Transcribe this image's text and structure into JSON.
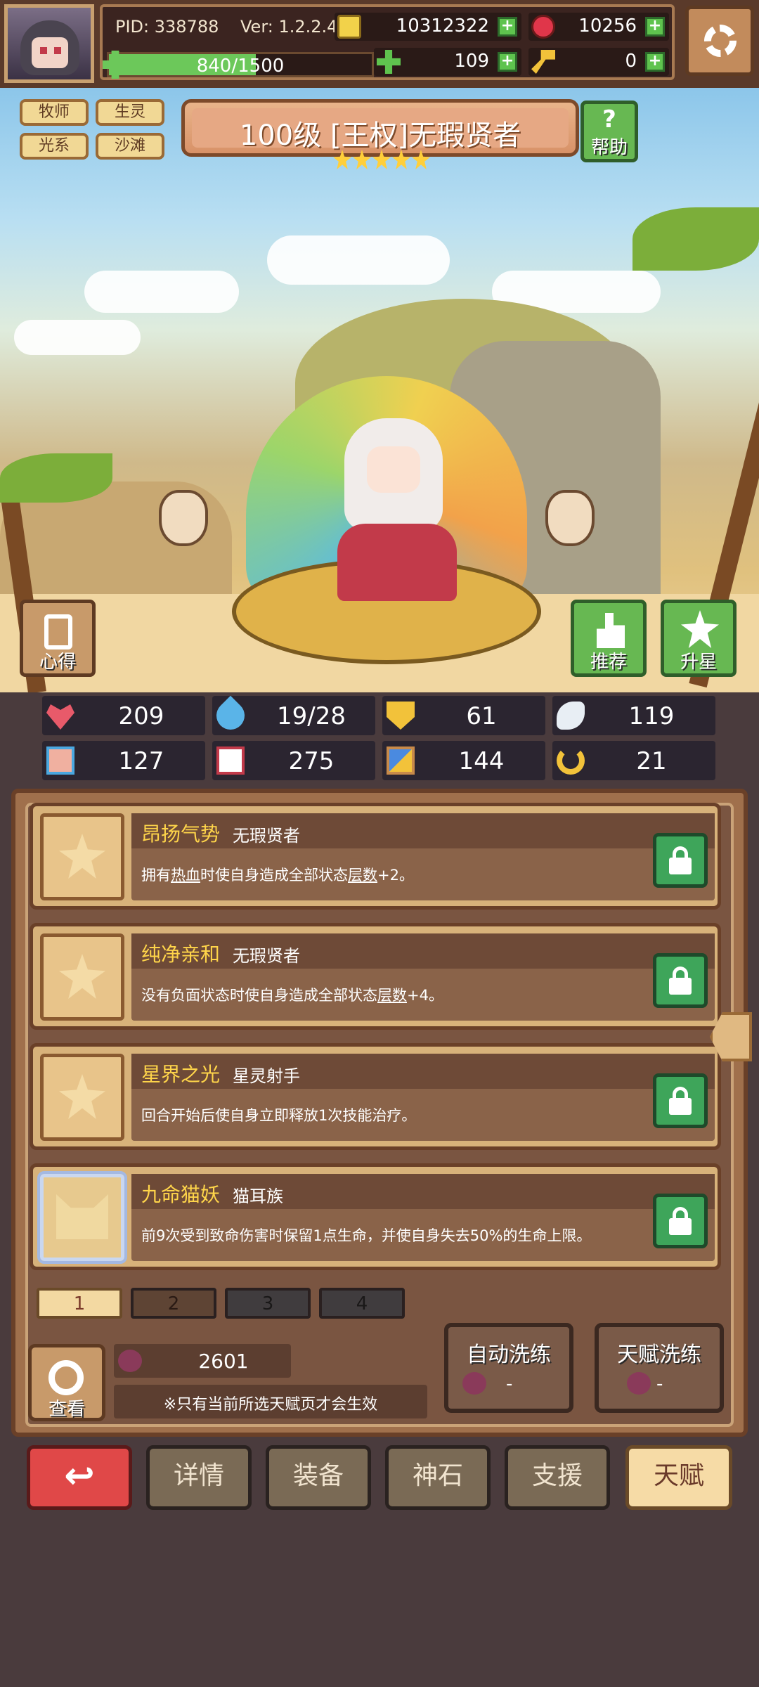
{
  "topbar": {
    "pid": "PID: 338788",
    "version": "Ver: 1.2.2.4",
    "gold": "10312322",
    "gems": "10256",
    "clover": "109",
    "key": "0",
    "exp": "840/1500",
    "exp_fraction": 0.56
  },
  "hero": {
    "tags": [
      "牧师",
      "生灵",
      "光系",
      "沙滩"
    ],
    "name": "100级 [王权]无瑕贤者",
    "star_count": 5,
    "help_label": "帮助",
    "notes_label": "心得",
    "recommend_label": "推荐",
    "star_up_label": "升星"
  },
  "stats": [
    "209",
    "19/28",
    "61",
    "119",
    "127",
    "275",
    "144",
    "21"
  ],
  "talents": [
    {
      "title": "昂扬气势",
      "source": "无瑕贤者",
      "desc_before": "拥有",
      "keyword1": "热血",
      "desc_middle": "时使自身造成全部状态",
      "keyword2": "层数",
      "desc_after": "+2。"
    },
    {
      "title": "纯净亲和",
      "source": "无瑕贤者",
      "desc_before": "没有负面状态时使自身造成全部状态",
      "keyword1": "",
      "desc_middle": "",
      "keyword2": "层数",
      "desc_after": "+4。"
    },
    {
      "title": "星界之光",
      "source": "星灵射手",
      "desc_before": "回合开始后使自身立即释放1次技能治疗。",
      "keyword1": "",
      "desc_middle": "",
      "keyword2": "",
      "desc_after": ""
    },
    {
      "title": "九命猫妖",
      "source": "猫耳族",
      "desc_before": "前9次受到致命伤害时保留1点生命，并使自身失去50%的生命上限。",
      "keyword1": "",
      "desc_middle": "",
      "keyword2": "",
      "desc_after": ""
    }
  ],
  "pages": [
    "1",
    "2",
    "3",
    "4"
  ],
  "footer": {
    "view_label": "查看",
    "points": "2601",
    "note": "※只有当前所选天赋页才会生效",
    "auto_reroll_label": "自动洗练",
    "auto_reroll_cost": "-",
    "talent_reroll_label": "天赋洗练",
    "talent_reroll_cost": "-"
  },
  "nav": [
    "详情",
    "装备",
    "神石",
    "支援",
    "天赋"
  ],
  "colors": {
    "accent_green": "#67b852",
    "title_gold": "#ffd54a",
    "back_red": "#e04848",
    "active_tab": "#f6dba6"
  }
}
